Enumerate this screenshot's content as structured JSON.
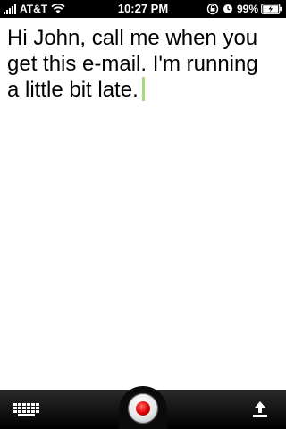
{
  "status_bar": {
    "carrier": "AT&T",
    "time": "10:27 PM",
    "battery_percent": "99%",
    "icons": [
      "signal-icon",
      "wifi-icon",
      "rotation-lock-icon",
      "alarm-icon",
      "battery-icon"
    ]
  },
  "note": {
    "text": "Hi John, call me when you get this e-mail. I'm running a little bit late."
  },
  "toolbar": {
    "icons": [
      "keyboard-icon",
      "record-icon",
      "share-icon"
    ],
    "record_color": "#e00000"
  },
  "colors": {
    "cursor": "#a6d97a",
    "toolbar": "#000000",
    "background": "#ffffff"
  }
}
